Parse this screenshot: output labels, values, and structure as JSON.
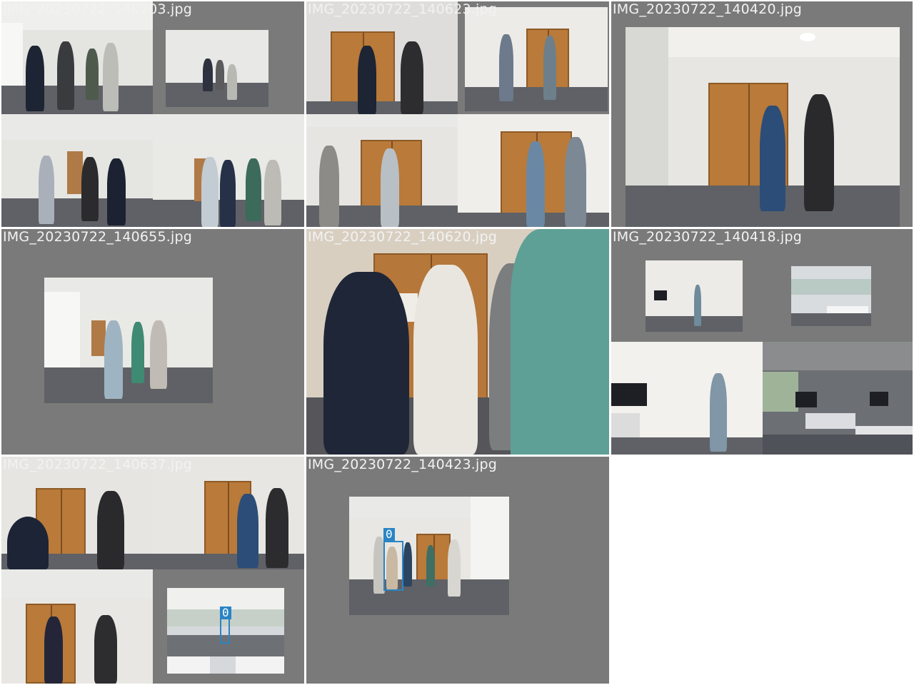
{
  "grid": {
    "tiles": [
      {
        "label": "IMG_20230722_140703.jpg"
      },
      {
        "label": "IMG_20230722_140623.jpg"
      },
      {
        "label": "IMG_20230722_140420.jpg"
      },
      {
        "label": "IMG_20230722_140655.jpg"
      },
      {
        "label": "IMG_20230722_140620.jpg"
      },
      {
        "label": "IMG_20230722_140418.jpg"
      },
      {
        "label": "IMG_20230722_140637.jpg"
      },
      {
        "label": "IMG_20230722_140423.jpg"
      }
    ]
  },
  "detections": [
    {
      "tile": 6,
      "tag": "0"
    },
    {
      "tile": 7,
      "tag": "0"
    }
  ],
  "colors": {
    "tile_background": "#7a7a7a",
    "page_background": "#ffffff",
    "label_text": "#f2f2f2",
    "bbox": "#2a84c6",
    "door": "#b97a3a",
    "wall": "#e6e6e3",
    "floor": "#5f6166"
  }
}
